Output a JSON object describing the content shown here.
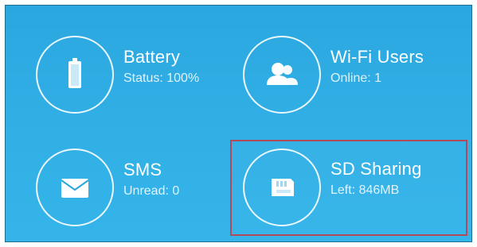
{
  "tiles": {
    "battery": {
      "title": "Battery",
      "subtitle": "Status: 100%",
      "icon": "battery-icon"
    },
    "wifi_users": {
      "title": "Wi-Fi Users",
      "subtitle": "Online: 1",
      "icon": "users-icon"
    },
    "sms": {
      "title": "SMS",
      "subtitle": "Unread: 0",
      "icon": "envelope-icon"
    },
    "sd_sharing": {
      "title": "SD Sharing",
      "subtitle": "Left: 846MB",
      "icon": "sd-card-icon"
    }
  },
  "colors": {
    "background": "#2aa7df",
    "text": "#ffffff",
    "highlight_border": "#b24a5a"
  }
}
